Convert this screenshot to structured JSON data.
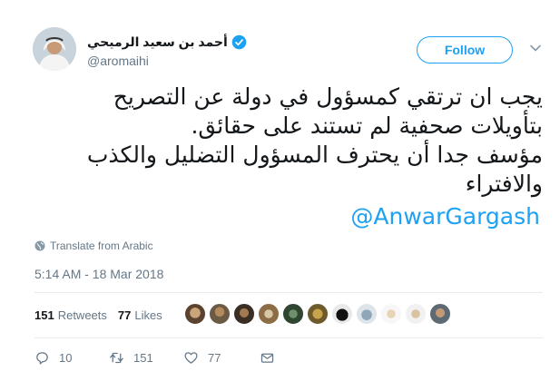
{
  "header": {
    "display_name": "أحمد بن سعيد الرميحي",
    "handle": "@aromaihi",
    "follow_label": "Follow"
  },
  "tweet": {
    "text_lines": [
      "يجب ان ترتقي كمسؤول في دولة عن التصريح",
      "بتأويلات صحفية لم تستند على حقائق.",
      "مؤسف جدا أن يحترف المسؤول التضليل والكذب",
      "والافتراء"
    ],
    "mention": "@AnwarGargash",
    "translate_label": "Translate from Arabic",
    "timestamp": "5:14 AM - 18 Mar 2018"
  },
  "stats": {
    "retweets_count": "151",
    "retweets_label": "Retweets",
    "likes_count": "77",
    "likes_label": "Likes"
  },
  "actions": {
    "reply_count": "10",
    "retweet_count": "151",
    "like_count": "77"
  },
  "icons": {
    "verified": "verified-badge-icon",
    "caret": "chevron-down-icon",
    "globe": "globe-icon",
    "reply": "reply-icon",
    "retweet": "retweet-icon",
    "like": "heart-icon",
    "dm": "envelope-icon"
  },
  "colors": {
    "accent": "#1da1f2",
    "secondary_text": "#657786",
    "primary_text": "#14171a",
    "divider": "#e6ecf0"
  }
}
